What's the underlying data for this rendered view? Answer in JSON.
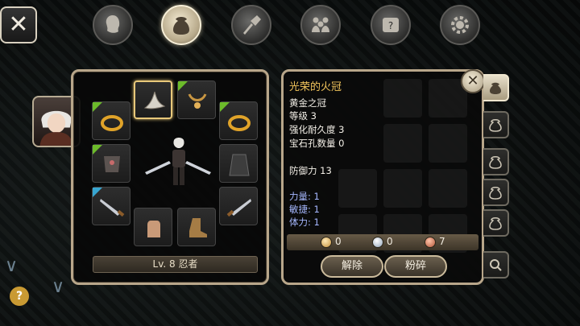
{
  "top_tabs": [
    {
      "icon": "head-icon",
      "active": false
    },
    {
      "icon": "bag-icon",
      "active": true
    },
    {
      "icon": "skill-icon",
      "active": false
    },
    {
      "icon": "party-icon",
      "active": false
    },
    {
      "icon": "quest-scroll-icon",
      "active": false
    },
    {
      "icon": "settings-gear-icon",
      "active": false
    }
  ],
  "equipment": {
    "level_label": "Lv. 8 忍者"
  },
  "item": {
    "name": "光荣的火冠",
    "type": "黄金之冠",
    "level": "等级 3",
    "durability": "强化耐久度 3",
    "gem_slots": "宝石孔数量 0",
    "defense": "防御力 13",
    "bonus_strength": "力量: 1",
    "bonus_agility": "敏捷: 1",
    "bonus_stamina": "体力: 1"
  },
  "currency": {
    "gold": "0",
    "silver": "0",
    "copper": "7"
  },
  "buttons": {
    "unequip": "解除",
    "shatter": "粉碎"
  },
  "colors": {
    "accent_gold": "#f2c55c",
    "panel_border": "#b8a68a",
    "bonus_stat": "#a6b8ff"
  }
}
